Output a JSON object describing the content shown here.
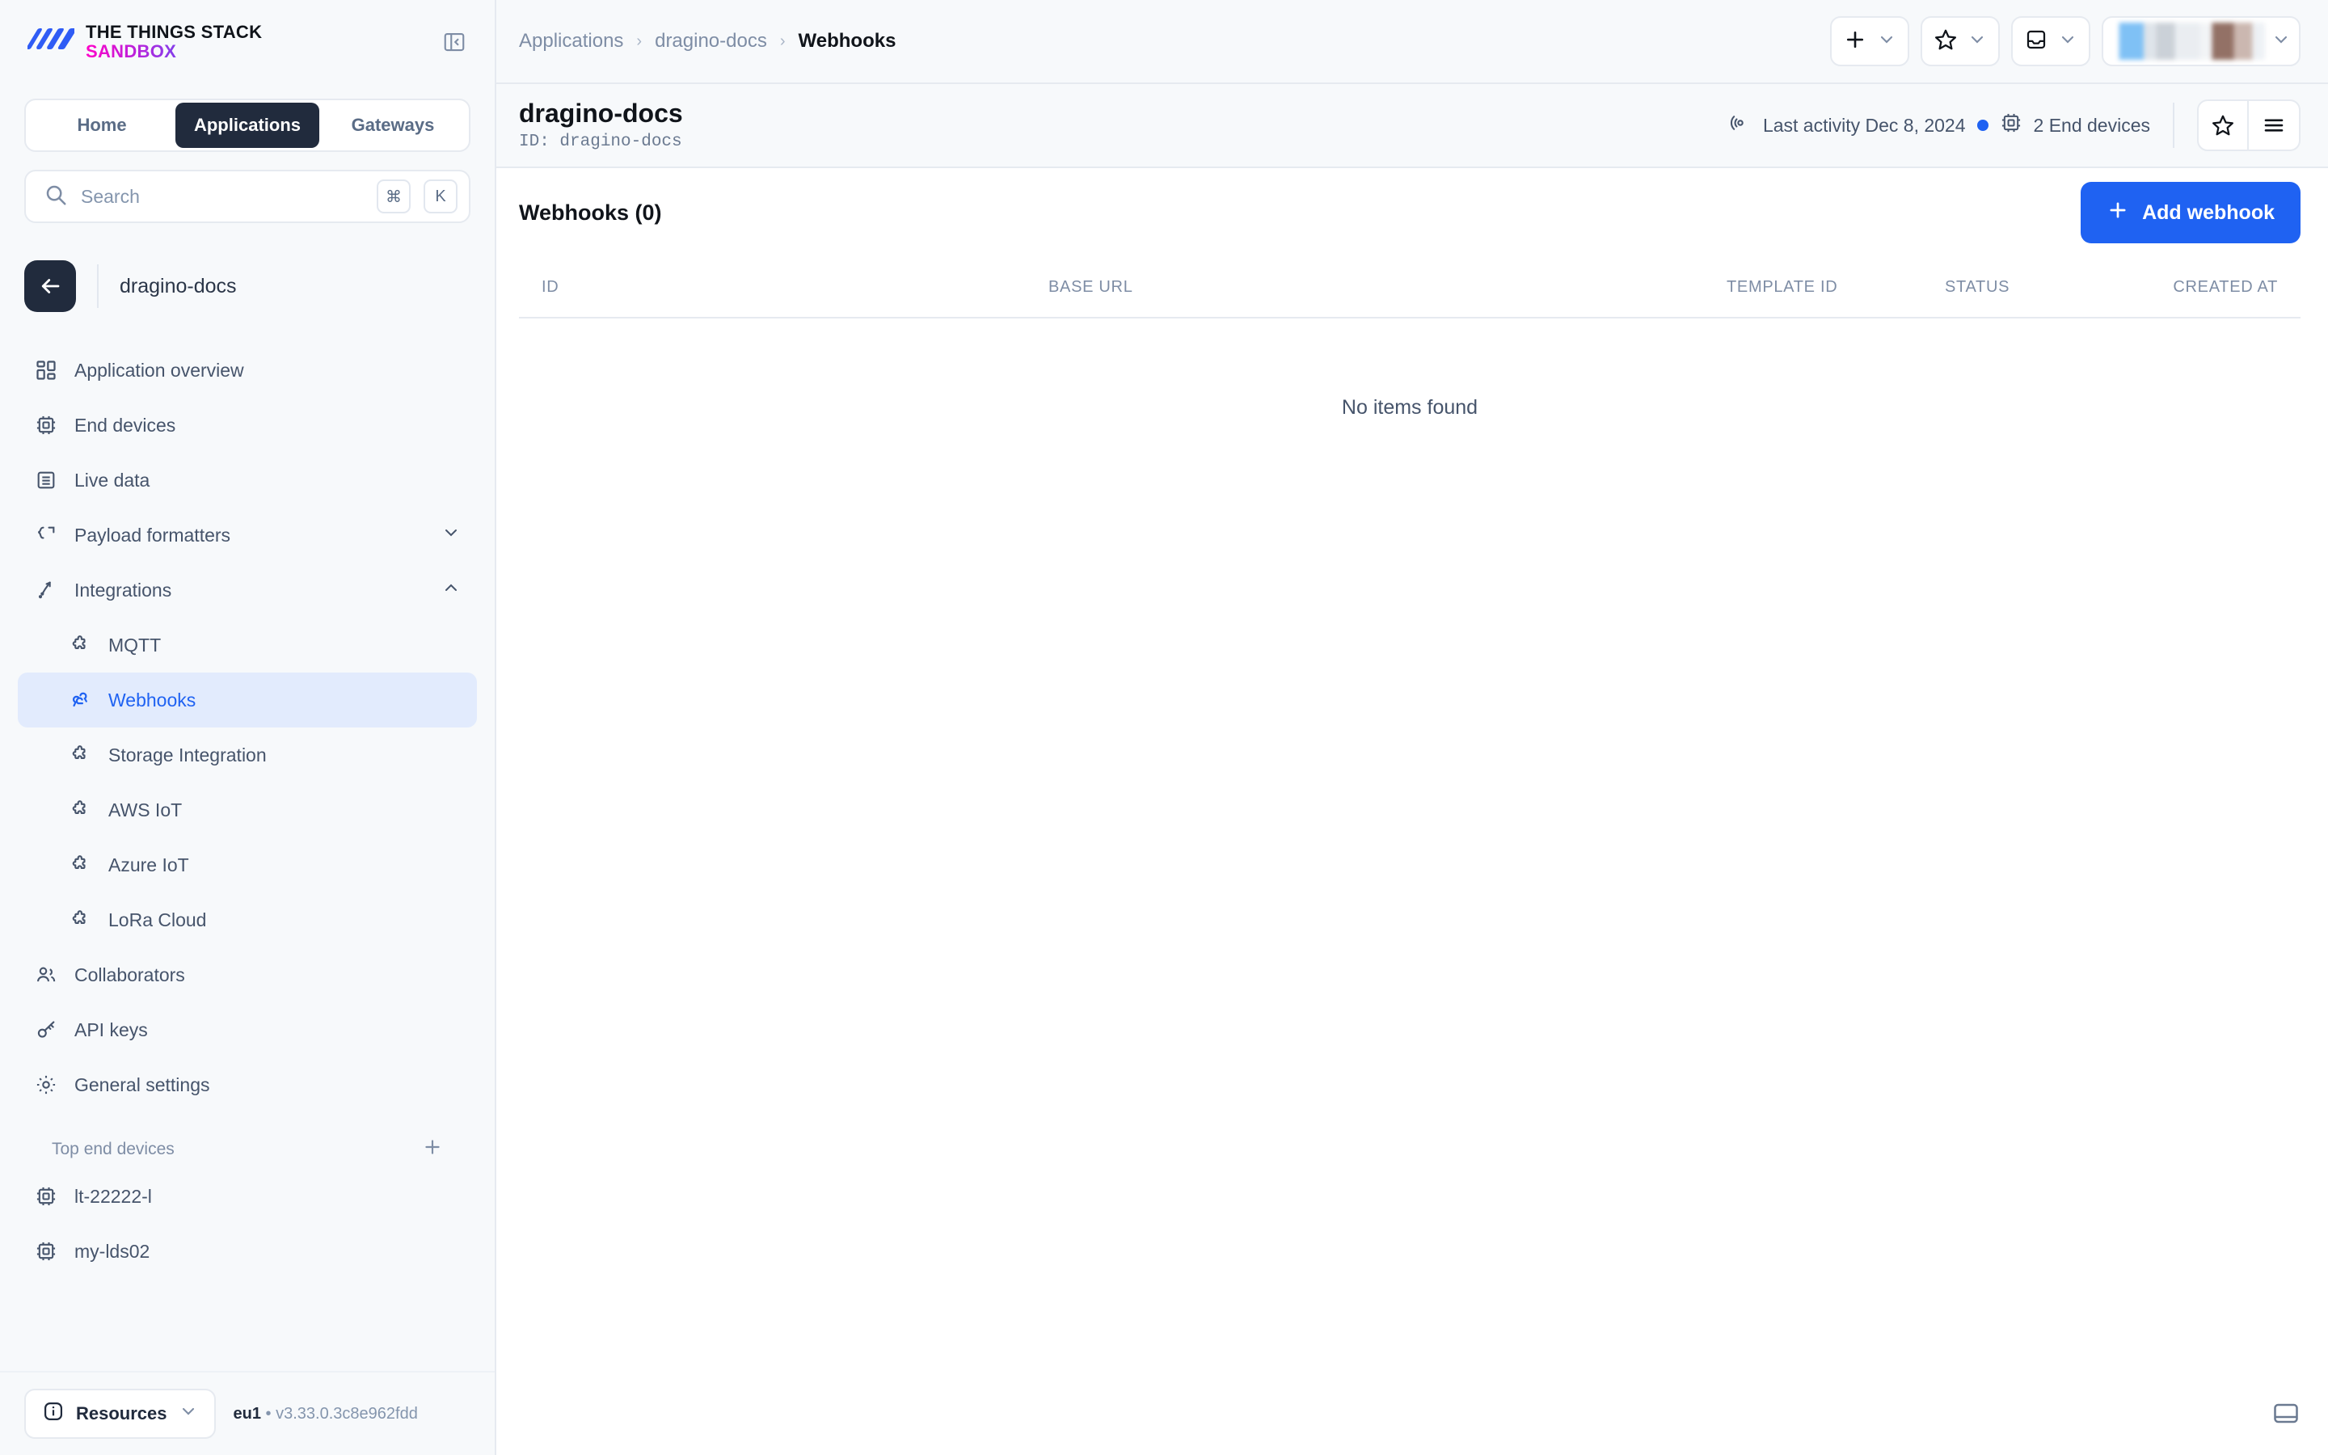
{
  "brand": {
    "line1": "THE THINGS STACK",
    "line2": "SANDBOX",
    "accent": "#1F62F2",
    "dark": "#212B3D"
  },
  "sidebar": {
    "tabs": [
      {
        "label": "Home",
        "active": false
      },
      {
        "label": "Applications",
        "active": true
      },
      {
        "label": "Gateways",
        "active": false
      }
    ],
    "search": {
      "placeholder": "Search",
      "value": "",
      "shortcut_keys": [
        "⌘",
        "K"
      ]
    },
    "application": {
      "name": "dragino-docs",
      "back_label": "Back"
    },
    "nav": [
      {
        "label": "Application overview",
        "icon": "dashboard-icon",
        "active": false
      },
      {
        "label": "End devices",
        "icon": "chip-icon",
        "active": false
      },
      {
        "label": "Live data",
        "icon": "list-icon",
        "active": false
      },
      {
        "label": "Payload formatters",
        "icon": "code-icon",
        "active": false,
        "expandable": true,
        "expanded": false
      },
      {
        "label": "Integrations",
        "icon": "integrations-icon",
        "active": false,
        "expandable": true,
        "expanded": true
      }
    ],
    "integrations_children": [
      {
        "label": "MQTT",
        "icon": "puzzle-icon",
        "active": false
      },
      {
        "label": "Webhooks",
        "icon": "webhook-icon",
        "active": true
      },
      {
        "label": "Storage Integration",
        "icon": "puzzle-icon",
        "active": false
      },
      {
        "label": "AWS IoT",
        "icon": "puzzle-icon",
        "active": false
      },
      {
        "label": "Azure IoT",
        "icon": "puzzle-icon",
        "active": false
      },
      {
        "label": "LoRa Cloud",
        "icon": "puzzle-icon",
        "active": false
      }
    ],
    "nav_after": [
      {
        "label": "Collaborators",
        "icon": "users-icon",
        "active": false
      },
      {
        "label": "API keys",
        "icon": "key-icon",
        "active": false
      },
      {
        "label": "General settings",
        "icon": "gear-icon",
        "active": false
      }
    ],
    "top_end_devices": {
      "title": "Top end devices",
      "add_label": "+",
      "items": [
        {
          "label": "lt-22222-l",
          "icon": "chip-icon"
        },
        {
          "label": "my-lds02",
          "icon": "chip-icon"
        }
      ]
    },
    "footer": {
      "resources_label": "Resources",
      "cluster": "eu1",
      "separator": "•",
      "version": "v3.33.0.3c8e962fdd"
    }
  },
  "topbar": {
    "breadcrumbs": [
      {
        "label": "Applications",
        "current": false
      },
      {
        "label": "dragino-docs",
        "current": false
      },
      {
        "label": "Webhooks",
        "current": true
      }
    ],
    "separator": "›",
    "actions": [
      {
        "name": "add-menu",
        "icon": "plus-icon"
      },
      {
        "name": "bookmarks-menu",
        "icon": "star-icon"
      },
      {
        "name": "notifications-menu",
        "icon": "inbox-icon"
      }
    ]
  },
  "page_header": {
    "title": "dragino-docs",
    "id_label": "ID: dragino-docs",
    "last_activity": "Last activity Dec 8, 2024",
    "end_devices": "2 End devices",
    "star_button": "star-icon",
    "menu_button": "hamburger-icon"
  },
  "main": {
    "section_title": "Webhooks (0)",
    "add_button": "Add webhook",
    "table": {
      "columns": [
        "ID",
        "BASE URL",
        "TEMPLATE ID",
        "STATUS",
        "CREATED AT"
      ],
      "rows": [],
      "empty_message": "No items found"
    }
  }
}
